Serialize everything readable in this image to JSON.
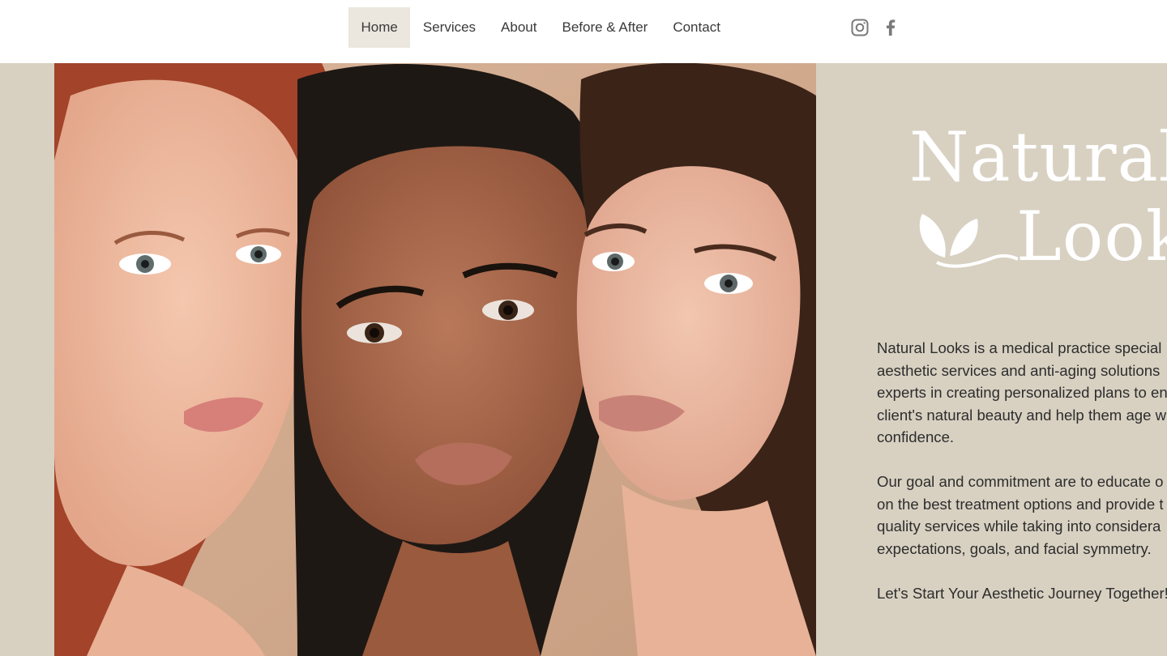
{
  "nav": {
    "items": [
      {
        "label": "Home",
        "active": true
      },
      {
        "label": "Services",
        "active": false
      },
      {
        "label": "About",
        "active": false
      },
      {
        "label": "Before & After",
        "active": false
      },
      {
        "label": "Contact",
        "active": false
      }
    ]
  },
  "social": {
    "icons": [
      "instagram-icon",
      "facebook-icon"
    ]
  },
  "logo": {
    "line1": "Natural",
    "line2": "Looks"
  },
  "about": {
    "paragraph1": [
      "Natural Looks is a medical practice special",
      "aesthetic services and anti-aging solutions",
      "experts in creating personalized plans to en",
      "client's natural beauty and help them age w",
      "confidence."
    ],
    "paragraph2": [
      "Our goal and commitment are to educate o",
      "on the best treatment options and provide t",
      "quality services while taking into considera",
      "expectations, goals, and facial symmetry."
    ],
    "tagline": "Let's Start Your Aesthetic Journey Together!"
  },
  "colors": {
    "background": "#d8d1c2",
    "header": "#ffffff",
    "nav_active": "#ebe6de",
    "text": "#2d2d2d",
    "logo": "#ffffff"
  }
}
